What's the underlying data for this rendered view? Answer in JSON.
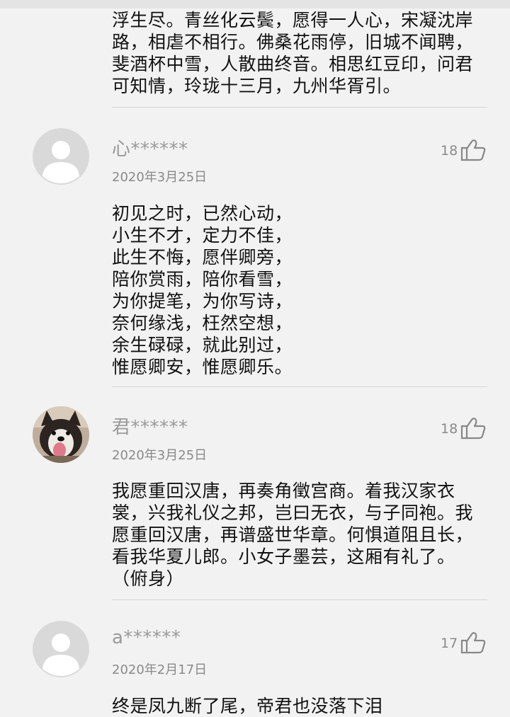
{
  "comments": [
    {
      "text": "浮生尽。青丝化云鬓，愿得一人心，宋凝沈岸\n路，相虐不相行。佛桑花雨停，旧城不闻聘，\n斐酒杯中雪，人散曲终音。相思红豆印，问君\n可知情，玲珑十三月，九州华胥引。"
    },
    {
      "username": "心******",
      "date": "2020年3月25日",
      "likes": "18",
      "avatar": "default",
      "text": "初见之时，已然心动，\n小生不才，定力不佳，\n此生不悔，愿伴卿旁，\n陪你赏雨，陪你看雪，\n为你提笔，为你写诗，\n奈何缘浅，枉然空想，\n余生碌碌，就此别过，\n惟愿卿安，惟愿卿乐。"
    },
    {
      "username": "君******",
      "date": "2020年3月25日",
      "likes": "18",
      "avatar": "dog-photo",
      "text": "我愿重回汉唐，再奏角徵宫商。着我汉家衣\n裳，兴我礼仪之邦，岂曰无衣，与子同袍。我\n愿重回汉唐，再谱盛世华章。何惧道阻且长，\n看我华夏儿郎。小女子墨芸，这厢有礼了。\n（俯身）"
    },
    {
      "username": "a******",
      "date": "2020年2月17日",
      "likes": "17",
      "avatar": "default",
      "text": "终是凤九断了尾，帝君也没落下泪"
    }
  ]
}
